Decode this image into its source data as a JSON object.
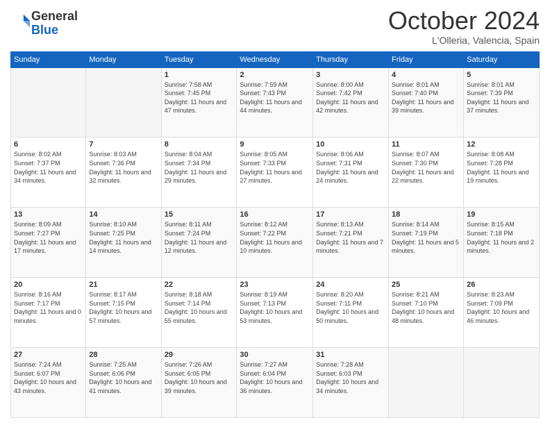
{
  "header": {
    "logo": {
      "line1": "General",
      "line2": "Blue"
    },
    "title": "October 2024",
    "location": "L'Olleria, Valencia, Spain"
  },
  "weekdays": [
    "Sunday",
    "Monday",
    "Tuesday",
    "Wednesday",
    "Thursday",
    "Friday",
    "Saturday"
  ],
  "weeks": [
    [
      {
        "day": "",
        "sunrise": "",
        "sunset": "",
        "daylight": ""
      },
      {
        "day": "",
        "sunrise": "",
        "sunset": "",
        "daylight": ""
      },
      {
        "day": "1",
        "sunrise": "Sunrise: 7:58 AM",
        "sunset": "Sunset: 7:45 PM",
        "daylight": "Daylight: 11 hours and 47 minutes."
      },
      {
        "day": "2",
        "sunrise": "Sunrise: 7:59 AM",
        "sunset": "Sunset: 7:43 PM",
        "daylight": "Daylight: 11 hours and 44 minutes."
      },
      {
        "day": "3",
        "sunrise": "Sunrise: 8:00 AM",
        "sunset": "Sunset: 7:42 PM",
        "daylight": "Daylight: 11 hours and 42 minutes."
      },
      {
        "day": "4",
        "sunrise": "Sunrise: 8:01 AM",
        "sunset": "Sunset: 7:40 PM",
        "daylight": "Daylight: 11 hours and 39 minutes."
      },
      {
        "day": "5",
        "sunrise": "Sunrise: 8:01 AM",
        "sunset": "Sunset: 7:39 PM",
        "daylight": "Daylight: 11 hours and 37 minutes."
      }
    ],
    [
      {
        "day": "6",
        "sunrise": "Sunrise: 8:02 AM",
        "sunset": "Sunset: 7:37 PM",
        "daylight": "Daylight: 11 hours and 34 minutes."
      },
      {
        "day": "7",
        "sunrise": "Sunrise: 8:03 AM",
        "sunset": "Sunset: 7:36 PM",
        "daylight": "Daylight: 11 hours and 32 minutes."
      },
      {
        "day": "8",
        "sunrise": "Sunrise: 8:04 AM",
        "sunset": "Sunset: 7:34 PM",
        "daylight": "Daylight: 11 hours and 29 minutes."
      },
      {
        "day": "9",
        "sunrise": "Sunrise: 8:05 AM",
        "sunset": "Sunset: 7:33 PM",
        "daylight": "Daylight: 11 hours and 27 minutes."
      },
      {
        "day": "10",
        "sunrise": "Sunrise: 8:06 AM",
        "sunset": "Sunset: 7:31 PM",
        "daylight": "Daylight: 11 hours and 24 minutes."
      },
      {
        "day": "11",
        "sunrise": "Sunrise: 8:07 AM",
        "sunset": "Sunset: 7:30 PM",
        "daylight": "Daylight: 11 hours and 22 minutes."
      },
      {
        "day": "12",
        "sunrise": "Sunrise: 8:08 AM",
        "sunset": "Sunset: 7:28 PM",
        "daylight": "Daylight: 11 hours and 19 minutes."
      }
    ],
    [
      {
        "day": "13",
        "sunrise": "Sunrise: 8:09 AM",
        "sunset": "Sunset: 7:27 PM",
        "daylight": "Daylight: 11 hours and 17 minutes."
      },
      {
        "day": "14",
        "sunrise": "Sunrise: 8:10 AM",
        "sunset": "Sunset: 7:25 PM",
        "daylight": "Daylight: 11 hours and 14 minutes."
      },
      {
        "day": "15",
        "sunrise": "Sunrise: 8:11 AM",
        "sunset": "Sunset: 7:24 PM",
        "daylight": "Daylight: 11 hours and 12 minutes."
      },
      {
        "day": "16",
        "sunrise": "Sunrise: 8:12 AM",
        "sunset": "Sunset: 7:22 PM",
        "daylight": "Daylight: 11 hours and 10 minutes."
      },
      {
        "day": "17",
        "sunrise": "Sunrise: 8:13 AM",
        "sunset": "Sunset: 7:21 PM",
        "daylight": "Daylight: 11 hours and 7 minutes."
      },
      {
        "day": "18",
        "sunrise": "Sunrise: 8:14 AM",
        "sunset": "Sunset: 7:19 PM",
        "daylight": "Daylight: 11 hours and 5 minutes."
      },
      {
        "day": "19",
        "sunrise": "Sunrise: 8:15 AM",
        "sunset": "Sunset: 7:18 PM",
        "daylight": "Daylight: 11 hours and 2 minutes."
      }
    ],
    [
      {
        "day": "20",
        "sunrise": "Sunrise: 8:16 AM",
        "sunset": "Sunset: 7:17 PM",
        "daylight": "Daylight: 11 hours and 0 minutes."
      },
      {
        "day": "21",
        "sunrise": "Sunrise: 8:17 AM",
        "sunset": "Sunset: 7:15 PM",
        "daylight": "Daylight: 10 hours and 57 minutes."
      },
      {
        "day": "22",
        "sunrise": "Sunrise: 8:18 AM",
        "sunset": "Sunset: 7:14 PM",
        "daylight": "Daylight: 10 hours and 55 minutes."
      },
      {
        "day": "23",
        "sunrise": "Sunrise: 8:19 AM",
        "sunset": "Sunset: 7:13 PM",
        "daylight": "Daylight: 10 hours and 53 minutes."
      },
      {
        "day": "24",
        "sunrise": "Sunrise: 8:20 AM",
        "sunset": "Sunset: 7:11 PM",
        "daylight": "Daylight: 10 hours and 50 minutes."
      },
      {
        "day": "25",
        "sunrise": "Sunrise: 8:21 AM",
        "sunset": "Sunset: 7:10 PM",
        "daylight": "Daylight: 10 hours and 48 minutes."
      },
      {
        "day": "26",
        "sunrise": "Sunrise: 8:23 AM",
        "sunset": "Sunset: 7:09 PM",
        "daylight": "Daylight: 10 hours and 46 minutes."
      }
    ],
    [
      {
        "day": "27",
        "sunrise": "Sunrise: 7:24 AM",
        "sunset": "Sunset: 6:07 PM",
        "daylight": "Daylight: 10 hours and 43 minutes."
      },
      {
        "day": "28",
        "sunrise": "Sunrise: 7:25 AM",
        "sunset": "Sunset: 6:06 PM",
        "daylight": "Daylight: 10 hours and 41 minutes."
      },
      {
        "day": "29",
        "sunrise": "Sunrise: 7:26 AM",
        "sunset": "Sunset: 6:05 PM",
        "daylight": "Daylight: 10 hours and 39 minutes."
      },
      {
        "day": "30",
        "sunrise": "Sunrise: 7:27 AM",
        "sunset": "Sunset: 6:04 PM",
        "daylight": "Daylight: 10 hours and 36 minutes."
      },
      {
        "day": "31",
        "sunrise": "Sunrise: 7:28 AM",
        "sunset": "Sunset: 6:03 PM",
        "daylight": "Daylight: 10 hours and 34 minutes."
      },
      {
        "day": "",
        "sunrise": "",
        "sunset": "",
        "daylight": ""
      },
      {
        "day": "",
        "sunrise": "",
        "sunset": "",
        "daylight": ""
      }
    ]
  ]
}
